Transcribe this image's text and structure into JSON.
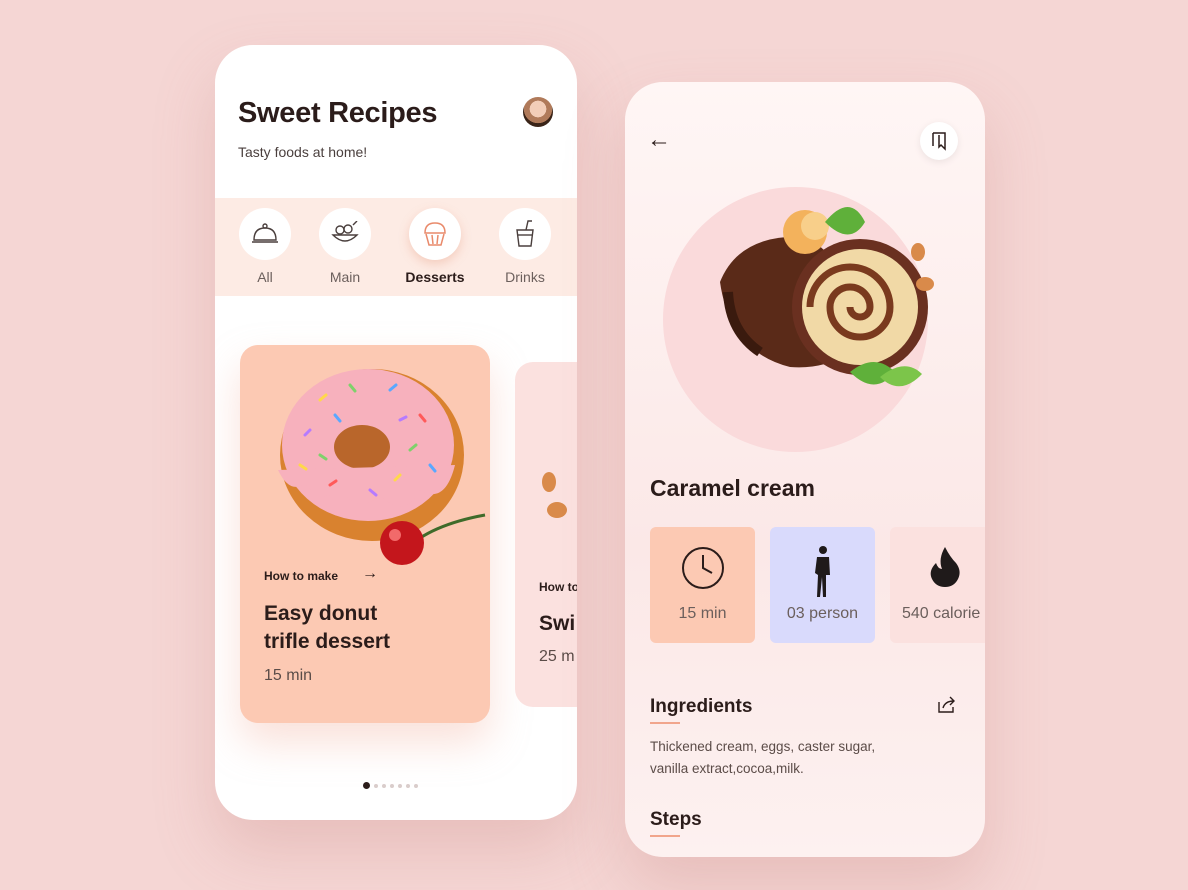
{
  "home": {
    "title": "Sweet Recipes",
    "subtitle": "Tasty foods at home!",
    "categories": [
      {
        "label": "All",
        "icon": "cloche-icon"
      },
      {
        "label": "Main",
        "icon": "salad-bowl-icon"
      },
      {
        "label": "Desserts",
        "icon": "cupcake-icon",
        "active": true
      },
      {
        "label": "Drinks",
        "icon": "cup-straw-icon"
      }
    ],
    "featured_card": {
      "how_to": "How to make",
      "title": "Easy donut\ntrifle dessert",
      "time": "15 min"
    },
    "next_card": {
      "how_to": "How to",
      "title": "Swi",
      "time": "25 m"
    },
    "pagination": {
      "total": 7,
      "active_index": 0
    }
  },
  "detail": {
    "title": "Caramel cream",
    "stats": [
      {
        "value": "15 min",
        "icon": "clock-icon",
        "color": "#fcc9b3"
      },
      {
        "value": "03 person",
        "icon": "person-icon",
        "color": "#d9dafc"
      },
      {
        "value": "540 calorie",
        "icon": "fire-icon",
        "color": "#fbe1df"
      }
    ],
    "ingredients_heading": "Ingredients",
    "ingredients_text": "Thickened cream, eggs, caster sugar, vanilla extract,cocoa,milk.",
    "steps_heading": "Steps"
  },
  "colors": {
    "background": "#f5d6d4",
    "card_peach": "#fcc9b3",
    "card_lavender": "#d9dafc",
    "card_pink": "#fbe1df",
    "accent": "#f1a58c"
  }
}
